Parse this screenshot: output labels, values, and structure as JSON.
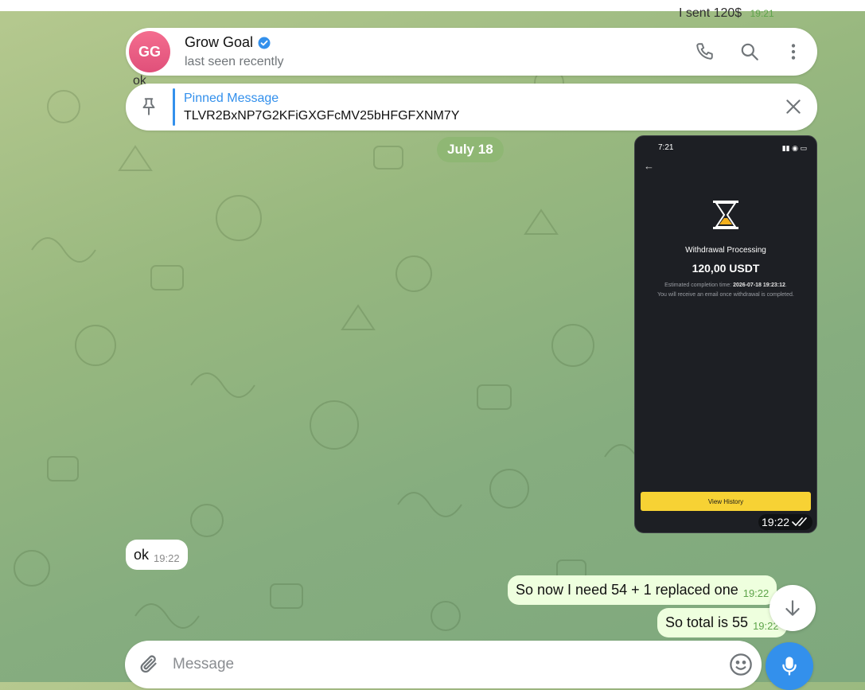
{
  "chat": {
    "avatar_initials": "GG",
    "name": "Grow Goal",
    "status": "last seen recently"
  },
  "pinned": {
    "title": "Pinned Message",
    "text": "TLVR2BxNP7G2KFiGXGFcMV25bHFGFXNM7Y"
  },
  "partial_messages": {
    "top_out": "I sent 120$",
    "top_out_time": "19:21",
    "top_in": "ok"
  },
  "date_separator": "July 18",
  "image_message": {
    "phone_time": "7:21",
    "title": "Withdrawal Processing",
    "amount": "120,00 USDT",
    "note_prefix": "Estimated completion time: ",
    "note_time": "2026-07-18 19:23:12",
    "note_line2": "You will receive an email once withdrawal is completed.",
    "button": "View History",
    "time": "19:22"
  },
  "messages": [
    {
      "text": "ok",
      "time": "19:22",
      "direction": "in"
    },
    {
      "text": "So now I need 54 + 1 replaced one",
      "time": "19:22",
      "direction": "out"
    },
    {
      "text": "So total is 55",
      "time": "19:22",
      "direction": "out"
    }
  ],
  "composer": {
    "placeholder": "Message"
  },
  "colors": {
    "accent": "#3390ec",
    "outgoing_bubble": "#eeffde",
    "incoming_bubble": "#ffffff",
    "date_pill": "#8fb774",
    "avatar": "#e0507a",
    "view_history_button": "#f7d234"
  },
  "icons": [
    "phone-icon",
    "search-icon",
    "more-vertical-icon",
    "pin-icon",
    "close-icon",
    "verified-icon",
    "double-check-icon",
    "hourglass-icon",
    "arrow-down-icon",
    "paperclip-icon",
    "emoji-icon",
    "microphone-icon"
  ]
}
